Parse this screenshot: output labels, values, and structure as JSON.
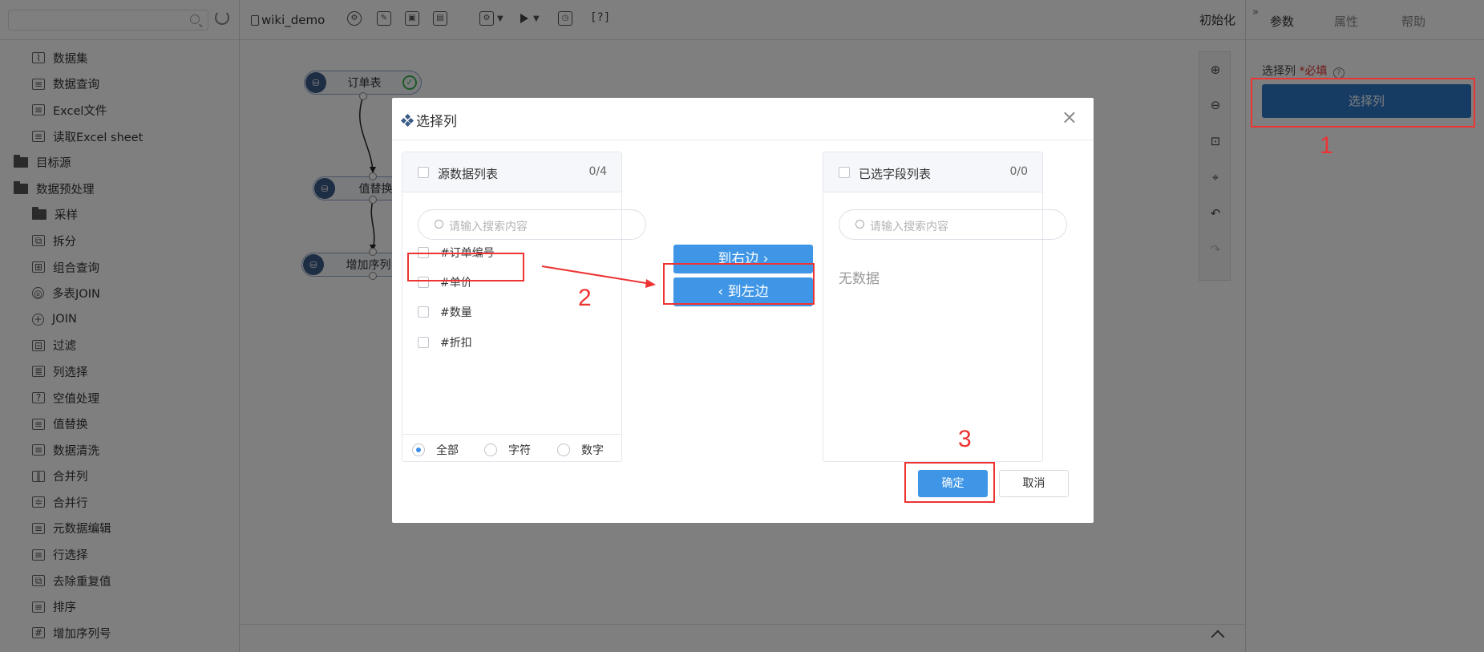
{
  "sidebar": {
    "search_placeholder": "",
    "items": [
      {
        "label": "数据集",
        "level": "child",
        "icon": "dataset-icon"
      },
      {
        "label": "数据查询",
        "level": "child",
        "icon": "db-query-icon"
      },
      {
        "label": "Excel文件",
        "level": "child",
        "icon": "excel-file-icon"
      },
      {
        "label": "读取Excel sheet",
        "level": "child",
        "icon": "excel-sheet-icon"
      },
      {
        "label": "目标源",
        "level": "group",
        "icon": "folder-icon"
      },
      {
        "label": "数据预处理",
        "level": "group",
        "icon": "folder-open-icon"
      },
      {
        "label": "采样",
        "level": "child",
        "icon": "folder-icon"
      },
      {
        "label": "拆分",
        "level": "child",
        "icon": "split-icon"
      },
      {
        "label": "组合查询",
        "level": "child",
        "icon": "combine-query-icon"
      },
      {
        "label": "多表JOIN",
        "level": "child",
        "icon": "join-multi-icon"
      },
      {
        "label": "JOIN",
        "level": "child",
        "icon": "join-icon"
      },
      {
        "label": "过滤",
        "level": "child",
        "icon": "filter-icon"
      },
      {
        "label": "列选择",
        "level": "child",
        "icon": "column-select-icon"
      },
      {
        "label": "空值处理",
        "level": "child",
        "icon": "null-handle-icon"
      },
      {
        "label": "值替换",
        "level": "child",
        "icon": "value-replace-icon"
      },
      {
        "label": "数据清洗",
        "level": "child",
        "icon": "data-clean-icon"
      },
      {
        "label": "合并列",
        "level": "child",
        "icon": "merge-columns-icon"
      },
      {
        "label": "合并行",
        "level": "child",
        "icon": "merge-rows-icon"
      },
      {
        "label": "元数据编辑",
        "level": "child",
        "icon": "metadata-edit-icon"
      },
      {
        "label": "行选择",
        "level": "child",
        "icon": "row-select-icon"
      },
      {
        "label": "去除重复值",
        "level": "child",
        "icon": "dedupe-icon"
      },
      {
        "label": "排序",
        "level": "child",
        "icon": "sort-icon"
      },
      {
        "label": "增加序列号",
        "level": "child",
        "icon": "add-serial-icon"
      }
    ]
  },
  "toolbar": {
    "title": "wiki_demo",
    "help_label": "[?]",
    "init_label": "初始化"
  },
  "canvas": {
    "nodes": [
      {
        "label": "订单表",
        "status": "success"
      },
      {
        "label": "值替换"
      },
      {
        "label": "增加序列"
      }
    ]
  },
  "right_panel": {
    "tabs": [
      "参数",
      "属性",
      "帮助"
    ],
    "active_tab": "参数",
    "field_label": "选择列",
    "required_label": "*必填",
    "help_icon": "?",
    "select_button": "选择列"
  },
  "modal": {
    "title": "选择列",
    "close": "×",
    "source": {
      "title": "源数据列表",
      "count": "0/4",
      "search_placeholder": "请输入搜索内容",
      "items": [
        "#订单编号",
        "#单价",
        "#数量",
        "#折扣"
      ],
      "filters": [
        "全部",
        "字符",
        "数字"
      ],
      "selected_filter": "全部"
    },
    "target": {
      "title": "已选字段列表",
      "count": "0/0",
      "search_placeholder": "请输入搜索内容",
      "empty": "无数据"
    },
    "to_right": "到右边 ›",
    "to_left": "‹ 到左边",
    "ok": "确定",
    "cancel": "取消"
  },
  "annotations": {
    "steps": [
      "1",
      "2",
      "3"
    ],
    "color": "#ee3333"
  },
  "colors": {
    "primary": "#3f96e6",
    "panel_button": "#2d78c9",
    "node_icon": "#3b5a86",
    "success": "#3cb34a"
  }
}
